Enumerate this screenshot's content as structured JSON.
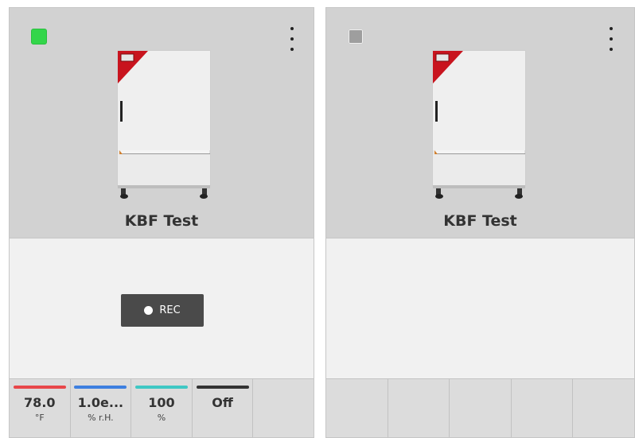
{
  "colors": {
    "status_active": "#33d64a",
    "status_idle": "#9e9e9e",
    "temp_bar": "#e8474a",
    "humidity_bar": "#3d7fe0",
    "percent_bar": "#3fc8c4",
    "off_bar": "#333333",
    "device_accent": "#c8141e"
  },
  "cards": [
    {
      "title": "KBF Test",
      "status": "active",
      "menu_icon": "kebab-menu-icon",
      "device_image": "climate-chamber-image",
      "rec_button": {
        "label": "REC",
        "icon": "record-dot-icon"
      },
      "tiles": [
        {
          "value": "78.0",
          "unit": "°F",
          "bar_color": "#e8474a"
        },
        {
          "value": "1.0e...",
          "unit": "% r.H.",
          "bar_color": "#3d7fe0"
        },
        {
          "value": "100",
          "unit": "%",
          "bar_color": "#3fc8c4"
        },
        {
          "value": "Off",
          "unit": "",
          "bar_color": "#333333"
        },
        {
          "value": "",
          "unit": "",
          "bar_color": ""
        }
      ]
    },
    {
      "title": "KBF Test",
      "status": "idle",
      "menu_icon": "kebab-menu-icon",
      "device_image": "climate-chamber-image",
      "tiles": [
        {
          "value": "",
          "unit": "",
          "bar_color": ""
        },
        {
          "value": "",
          "unit": "",
          "bar_color": ""
        },
        {
          "value": "",
          "unit": "",
          "bar_color": ""
        },
        {
          "value": "",
          "unit": "",
          "bar_color": ""
        },
        {
          "value": "",
          "unit": "",
          "bar_color": ""
        }
      ]
    }
  ]
}
